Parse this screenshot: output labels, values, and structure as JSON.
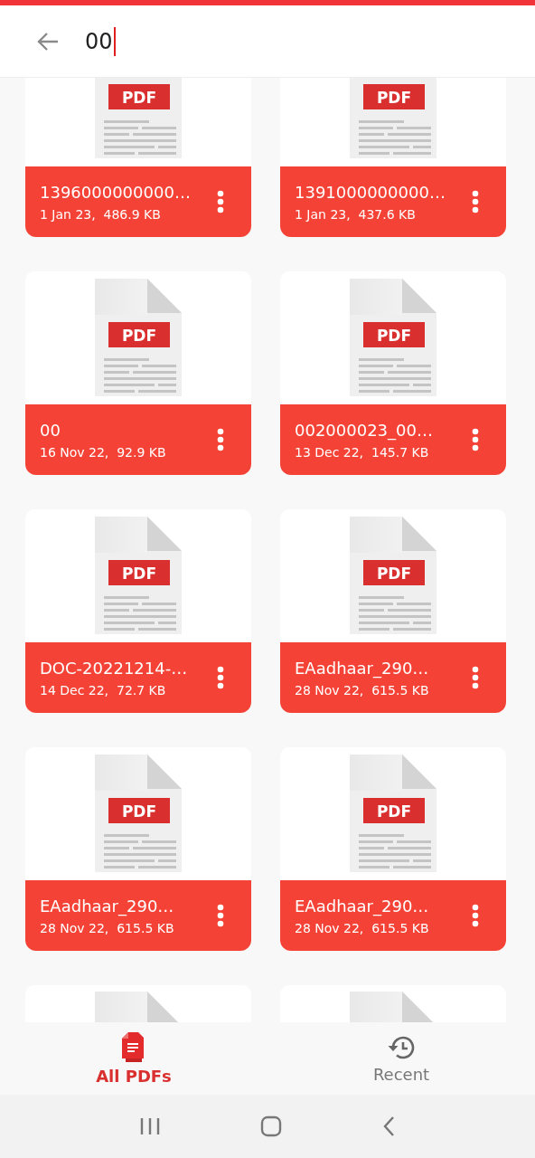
{
  "search": {
    "value": "00"
  },
  "files": [
    {
      "kind": "top_cut",
      "badge": "PDF",
      "name": "1396000000000…",
      "meta": "1 Jan 23,  486.9 KB"
    },
    {
      "kind": "top_cut",
      "badge": "PDF",
      "name": "1391000000000…",
      "meta": "1 Jan 23,  437.6 KB"
    },
    {
      "kind": "full",
      "badge": "PDF",
      "name": "00",
      "meta": "16 Nov 22,  92.9 KB"
    },
    {
      "kind": "full",
      "badge": "PDF",
      "name": "002000023_00…",
      "meta": "13 Dec 22,  145.7 KB"
    },
    {
      "kind": "full",
      "badge": "PDF",
      "name": "DOC-20221214-…",
      "meta": "14 Dec 22,  72.7 KB"
    },
    {
      "kind": "full",
      "badge": "PDF",
      "name": "EAadhaar_290…",
      "meta": "28 Nov 22,  615.5 KB"
    },
    {
      "kind": "full",
      "badge": "PDF",
      "name": "EAadhaar_290…",
      "meta": "28 Nov 22,  615.5 KB"
    },
    {
      "kind": "full",
      "badge": "PDF",
      "name": "EAadhaar_290…",
      "meta": "28 Nov 22,  615.5 KB"
    },
    {
      "kind": "bottom_cut"
    },
    {
      "kind": "bottom_cut"
    }
  ],
  "tabs": [
    {
      "label": "All PDFs",
      "selected": true
    },
    {
      "label": "Recent",
      "selected": false
    }
  ]
}
